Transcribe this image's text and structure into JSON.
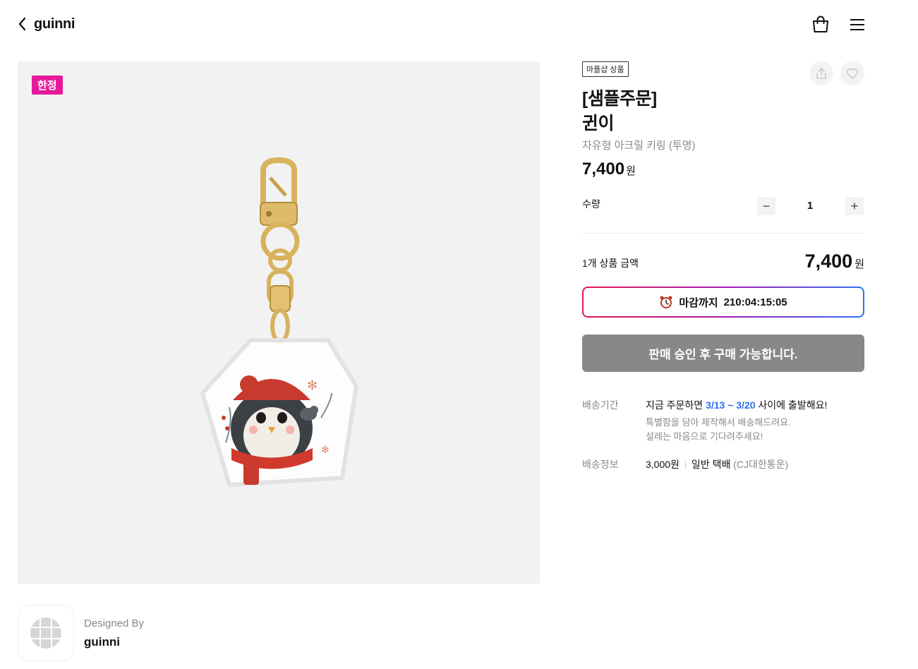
{
  "header": {
    "shop_name": "guinni",
    "icons": [
      "chevron-left-icon",
      "shopping-bag-icon",
      "hamburger-menu-icon"
    ]
  },
  "gallery": {
    "badge": "한정",
    "badge_color": "#e6199b",
    "background": "#f2f2f2"
  },
  "product": {
    "tag": "마플샵 상품",
    "title_line1": "[샘플주문]",
    "title_line2": "귄이",
    "subtitle": "자유형 아크릴 키링 (투명)",
    "price": "7,400",
    "price_unit": "원"
  },
  "quantity": {
    "label": "수량",
    "value": "1",
    "minus": "−",
    "plus": "+"
  },
  "total": {
    "label": "1개 상품 금액",
    "price": "7,400",
    "unit": "원"
  },
  "deadline": {
    "label": "마감까지",
    "time": "210:04:15:05",
    "icon": "alarm-clock-icon"
  },
  "buy_button": {
    "label": "판매 승인 후 구매 가능합니다.",
    "color": "#888888"
  },
  "shipping": {
    "period_key": "배송기간",
    "period_prefix": "지금 주문하면",
    "period_dates": "3/13 ~ 3/20",
    "period_suffix": "사이에 출발해요!",
    "note_line1": "특별함을 담아 제작해서 배송해드려요.",
    "note_line2": "설레는 마음으로 기다려주세요!",
    "info_key": "배송정보",
    "fee": "3,000원",
    "method": "일반 택배",
    "carrier": "(CJ대한통운)"
  },
  "designer": {
    "designed_by": "Designed By",
    "name": "guinni"
  },
  "colors": {
    "accent_blue": "#2f6ff0",
    "gradient_start": "#e0184f",
    "gradient_end": "#2f6ff0"
  }
}
